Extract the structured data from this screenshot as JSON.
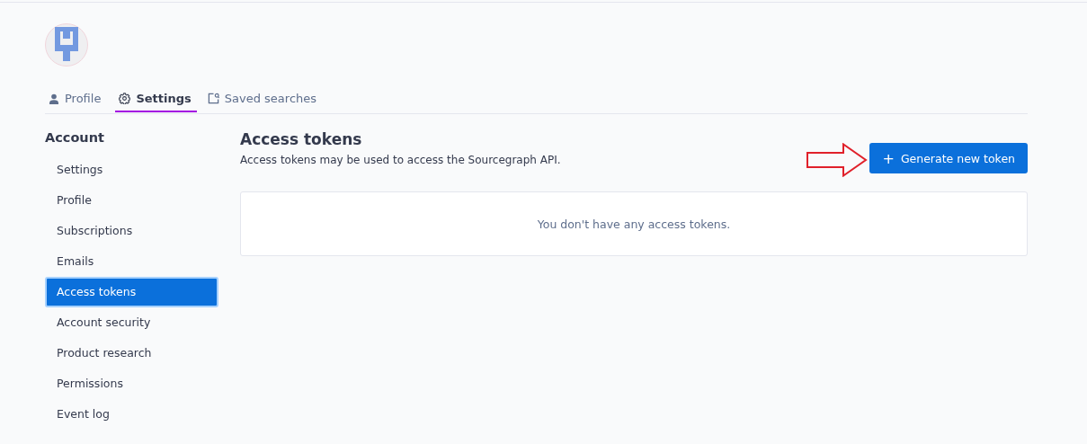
{
  "tabs": [
    {
      "label": "Profile",
      "kind": "person",
      "selected": false
    },
    {
      "label": "Settings",
      "kind": "gear",
      "selected": true
    },
    {
      "label": "Saved searches",
      "kind": "saved",
      "selected": false
    }
  ],
  "sidebar": {
    "heading": "Account",
    "items": [
      {
        "label": "Settings",
        "selected": false
      },
      {
        "label": "Profile",
        "selected": false
      },
      {
        "label": "Subscriptions",
        "selected": false
      },
      {
        "label": "Emails",
        "selected": false
      },
      {
        "label": "Access tokens",
        "selected": true
      },
      {
        "label": "Account security",
        "selected": false
      },
      {
        "label": "Product research",
        "selected": false
      },
      {
        "label": "Permissions",
        "selected": false
      },
      {
        "label": "Event log",
        "selected": false
      }
    ]
  },
  "main": {
    "title": "Access tokens",
    "description": "Access tokens may be used to access the Sourcegraph API.",
    "button": {
      "icon": "+",
      "label": "Generate new token"
    },
    "empty_message": "You don't have any access tokens."
  }
}
